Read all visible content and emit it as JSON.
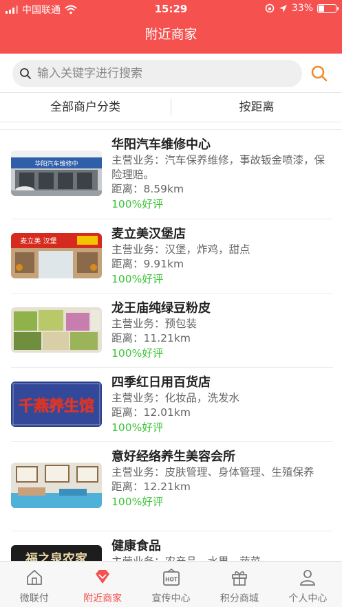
{
  "status_bar": {
    "carrier": "中国联通",
    "time": "15:29",
    "battery": "33%",
    "battery_level": 0.33
  },
  "nav": {
    "title": "附近商家"
  },
  "search": {
    "placeholder": "输入关键字进行搜索"
  },
  "filters": {
    "category": "全部商户分类",
    "distance": "按距离"
  },
  "shops": [
    {
      "name": "华阳汽车维修中心",
      "business": "主营业务：汽车保养维修，事故钣金喷漆，保险理赔。",
      "distance": "距离：8.59km",
      "rating": "100%好评",
      "thumb_text": "华阳汽车维修中"
    },
    {
      "name": "麦立美汉堡店",
      "business": "主营业务：汉堡，炸鸡，甜点",
      "distance": "距离：9.91km",
      "rating": "100%好评",
      "thumb_text": "麦立美 汉堡"
    },
    {
      "name": "龙王庙纯绿豆粉皮",
      "business": "主营业务：预包装",
      "distance": "距离：11.21km",
      "rating": "100%好评",
      "thumb_text": ""
    },
    {
      "name": "四季红日用百货店",
      "business": "主营业务：化妆品，洗发水",
      "distance": "距离：12.01km",
      "rating": "100%好评",
      "thumb_text": "千燕养生馆"
    },
    {
      "name": "意好经络养生美容会所",
      "business": "主营业务：皮肤管理、身体管理、生殖保养",
      "distance": "距离：12.21km",
      "rating": "100%好评",
      "thumb_text": ""
    },
    {
      "name": "健康食品",
      "business": "主营业务：农产品，水果，蔬菜",
      "distance": "",
      "rating": "",
      "thumb_text": "福之泉农家"
    }
  ],
  "tabs": [
    {
      "label": "微联付",
      "icon": "home-icon"
    },
    {
      "label": "附近商家",
      "icon": "diamond-icon"
    },
    {
      "label": "宣传中心",
      "icon": "hot-icon"
    },
    {
      "label": "积分商城",
      "icon": "gift-icon"
    },
    {
      "label": "个人中心",
      "icon": "person-icon"
    }
  ],
  "colors": {
    "brand": "#f5514f",
    "rating_green": "#3ec43a"
  }
}
